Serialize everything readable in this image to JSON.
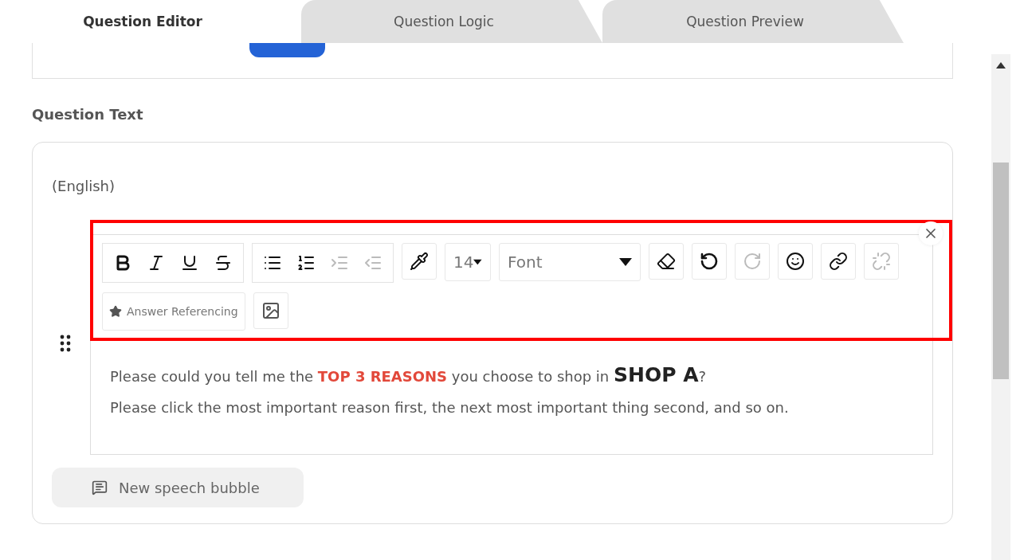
{
  "tabs": [
    {
      "label": "Question Editor",
      "selected": true
    },
    {
      "label": "Question Logic",
      "selected": false
    },
    {
      "label": "Question Preview",
      "selected": false
    }
  ],
  "section_title": "Question Text",
  "language": "(English)",
  "toolbar": {
    "groups": [
      {
        "buttons": [
          {
            "kind": "bold",
            "disabled": false
          },
          {
            "kind": "italic",
            "disabled": false
          },
          {
            "kind": "underline",
            "disabled": false
          },
          {
            "kind": "strikethrough",
            "disabled": false
          }
        ]
      },
      {
        "buttons": [
          {
            "kind": "bullet-list",
            "disabled": false
          },
          {
            "kind": "numbered-list",
            "disabled": false
          },
          {
            "kind": "indent",
            "disabled": true
          },
          {
            "kind": "outdent",
            "disabled": true
          }
        ]
      },
      {
        "buttons": [
          {
            "kind": "color",
            "disabled": false
          }
        ]
      }
    ],
    "font_size": "14",
    "font": "Font",
    "actions": [
      {
        "kind": "eraser",
        "disabled": false
      },
      {
        "kind": "undo",
        "disabled": false
      },
      {
        "kind": "redo",
        "disabled": true
      },
      {
        "kind": "emoji",
        "disabled": false
      },
      {
        "kind": "link",
        "disabled": false
      },
      {
        "kind": "unlink",
        "disabled": true
      }
    ],
    "answer_referencing": "Answer Referencing"
  },
  "body": [
    {
      "segments": [
        {
          "kind": "plain",
          "text": "Please could you tell me the "
        },
        {
          "kind": "highlight",
          "text": "TOP 3 REASONS"
        },
        {
          "kind": "plain",
          "text": " you choose to shop in "
        },
        {
          "kind": "emphasis",
          "text": "SHOP A"
        },
        {
          "kind": "plain",
          "text": "?"
        }
      ]
    },
    {
      "segments": [
        {
          "kind": "plain",
          "text": "Please click the most important reason first, the next most important thing second, and so on."
        }
      ]
    }
  ],
  "new_bubble_button": "New speech bubble"
}
